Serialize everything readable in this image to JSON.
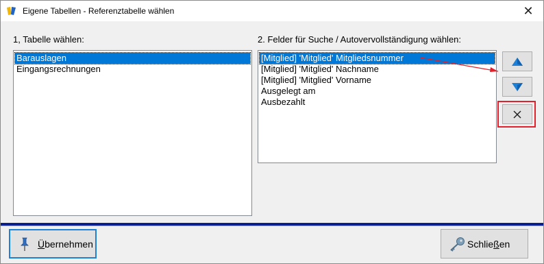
{
  "window": {
    "title": "Eigene Tabellen - Referenztabelle wählen",
    "close_glyph": "✕"
  },
  "left_panel": {
    "label": "1, Tabelle wählen:",
    "items": [
      {
        "text": "Barauslagen",
        "selected": true
      },
      {
        "text": "Eingangsrechnungen",
        "selected": false
      }
    ]
  },
  "right_panel": {
    "label": "2. Felder für Suche / Autovervollständigung wählen:",
    "items": [
      {
        "text": "[Mitglied] 'Mitglied' Mitgliedsnummer",
        "selected": true
      },
      {
        "text": "[Mitglied] 'Mitglied' Nachname",
        "selected": false
      },
      {
        "text": "[Mitglied] 'Mitglied' Vorname",
        "selected": false
      },
      {
        "text": "Ausgelegt am",
        "selected": false
      },
      {
        "text": "Ausbezahlt",
        "selected": false
      }
    ]
  },
  "side_buttons": {
    "up_icon": "arrow-up-icon",
    "down_icon": "arrow-down-icon",
    "remove_icon": "close-icon"
  },
  "annotation": {
    "color": "#e0202a"
  },
  "footer": {
    "apply_label_underlined": "Ü",
    "apply_label_rest": "bernehmen",
    "close_label_start": "Schlie",
    "close_label_underlined": "ß",
    "close_label_end": "en"
  },
  "colors": {
    "selection": "#0078d7",
    "accent_arrow": "#1e7fd6",
    "divider": "#0a1f8c"
  }
}
